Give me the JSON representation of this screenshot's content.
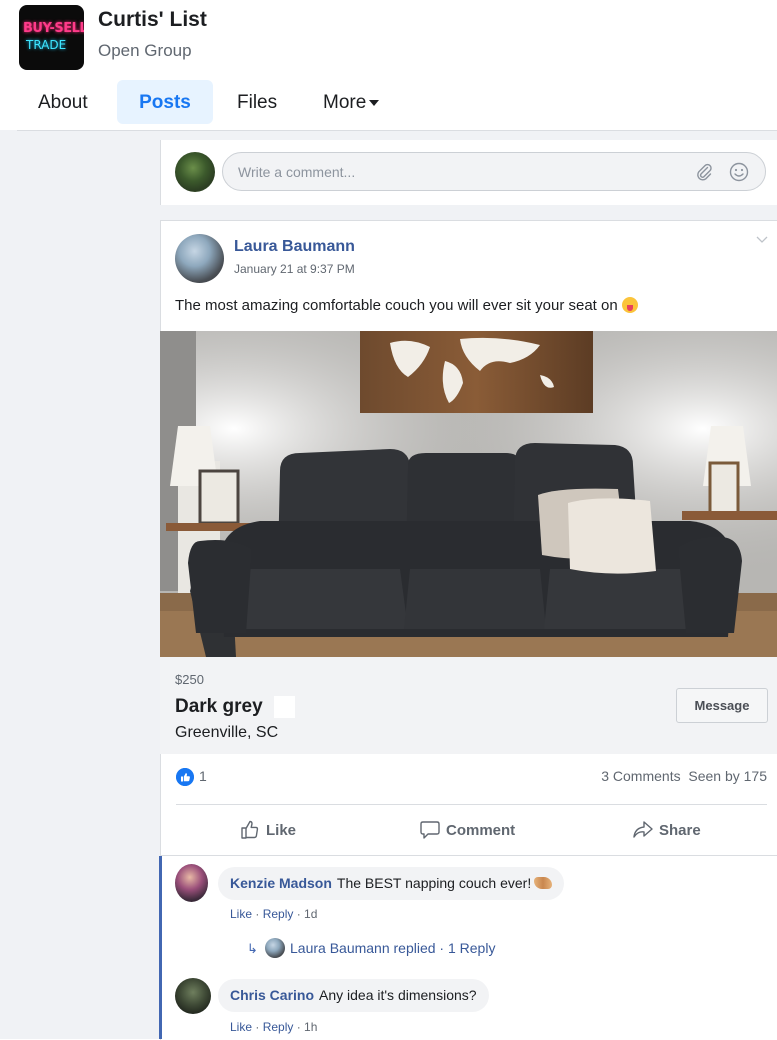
{
  "group": {
    "name": "Curtis' List",
    "type": "Open Group",
    "logo": {
      "line1": "BUY-SELL",
      "line2": "TRADE"
    }
  },
  "tabs": [
    {
      "label": "About"
    },
    {
      "label": "Posts",
      "active": true
    },
    {
      "label": "Files"
    },
    {
      "label": "More"
    }
  ],
  "composer": {
    "placeholder": "Write a comment...",
    "icons": [
      "paperclip-icon",
      "smiley-icon"
    ]
  },
  "post": {
    "author": "Laura Baumann",
    "timestamp": "January 21 at 9:37 PM",
    "text": "The most amazing comfortable couch you will ever sit your seat on",
    "listing": {
      "price": "$250",
      "title": "Dark grey",
      "location": "Greenville, SC",
      "message_label": "Message"
    },
    "reactions": {
      "count": "1"
    },
    "comments_seen": "3 Comments  Seen by 175",
    "actions": {
      "like": "Like",
      "comment": "Comment",
      "share": "Share"
    }
  },
  "comments": [
    {
      "author": "Kenzie Madson",
      "text": "The BEST napping couch ever!",
      "like": "Like",
      "reply": "Reply",
      "age": "1d",
      "replies_summary": "Laura Baumann replied · 1 Reply"
    },
    {
      "author": "Chris Carino",
      "text": "Any idea it's dimensions?",
      "like": "Like",
      "reply": "Reply",
      "age": "1h"
    }
  ],
  "colors": {
    "accent": "#1877f2",
    "link": "#385898",
    "muted": "#606770",
    "page_bg": "#f0f2f5"
  }
}
